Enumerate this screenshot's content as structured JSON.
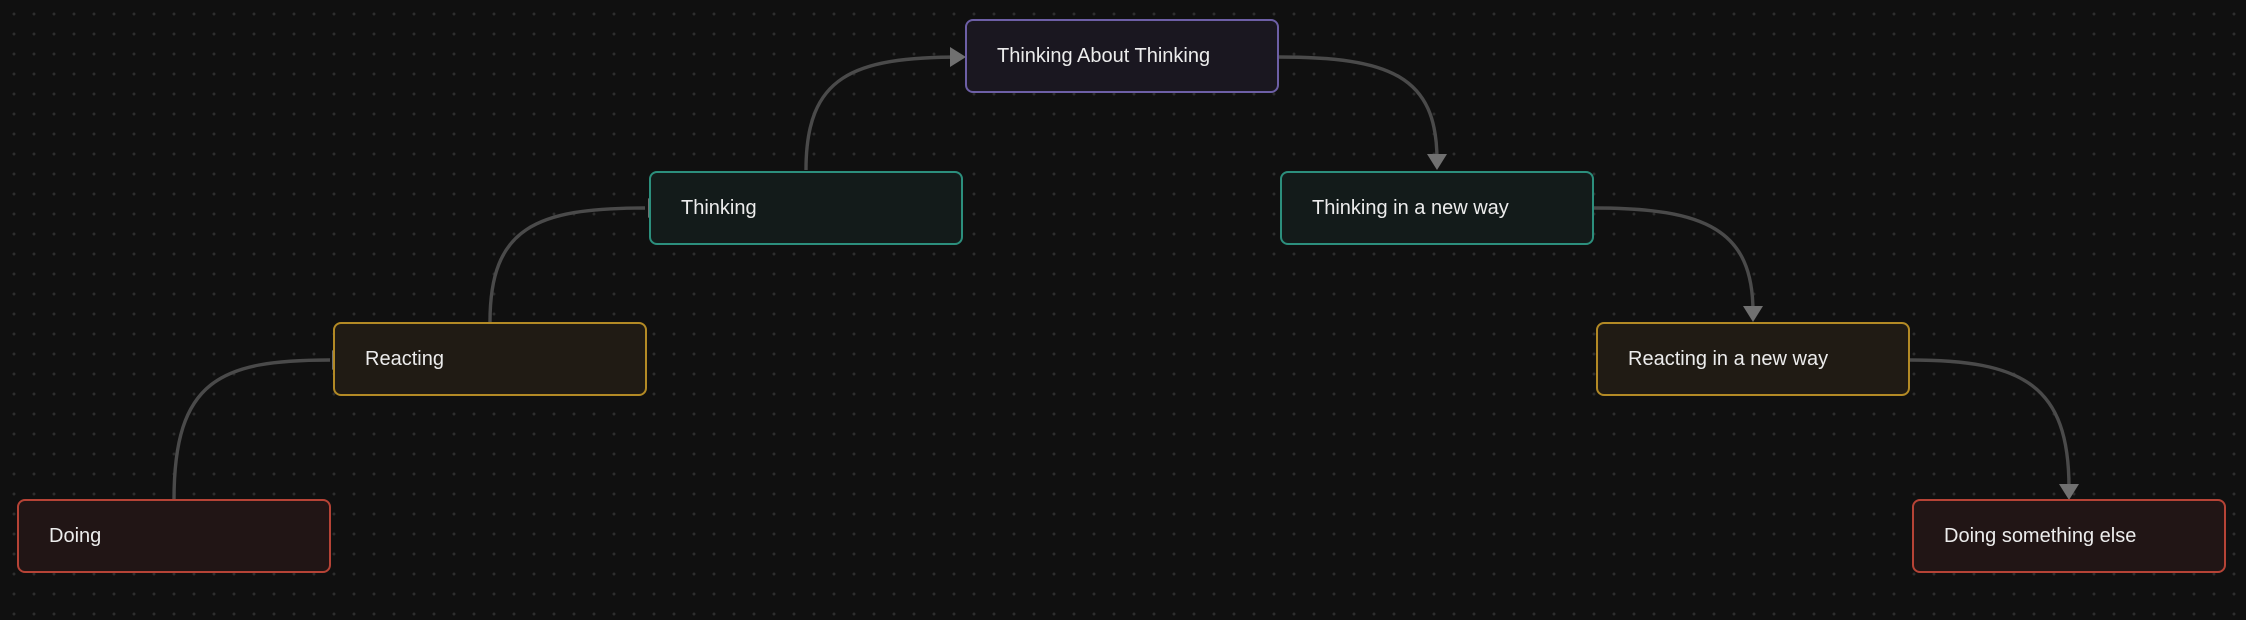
{
  "diagram": {
    "nodes": [
      {
        "id": "doing",
        "label": "Doing",
        "kind": "doing"
      },
      {
        "id": "reacting",
        "label": "Reacting",
        "kind": "react"
      },
      {
        "id": "thinking",
        "label": "Thinking",
        "kind": "think"
      },
      {
        "id": "meta",
        "label": "Thinking About Thinking",
        "kind": "meta"
      },
      {
        "id": "thinking-new",
        "label": "Thinking in a new way",
        "kind": "think"
      },
      {
        "id": "reacting-new",
        "label": "Reacting in a new way",
        "kind": "react"
      },
      {
        "id": "doing-else",
        "label": "Doing something else",
        "kind": "doing"
      }
    ],
    "edges": [
      {
        "from": "doing",
        "to": "reacting"
      },
      {
        "from": "reacting",
        "to": "thinking"
      },
      {
        "from": "thinking",
        "to": "meta"
      },
      {
        "from": "meta",
        "to": "thinking-new"
      },
      {
        "from": "thinking-new",
        "to": "reacting-new"
      },
      {
        "from": "reacting-new",
        "to": "doing-else"
      }
    ],
    "colors": {
      "background": "#101010",
      "edge": "#4a4a4a",
      "arrowhead": "#707070",
      "doing_border": "#b64336",
      "reacting_border": "#b38a25",
      "thinking_border": "#2c8f7d",
      "meta_border": "#6d5fa6",
      "text": "#ececec"
    }
  }
}
